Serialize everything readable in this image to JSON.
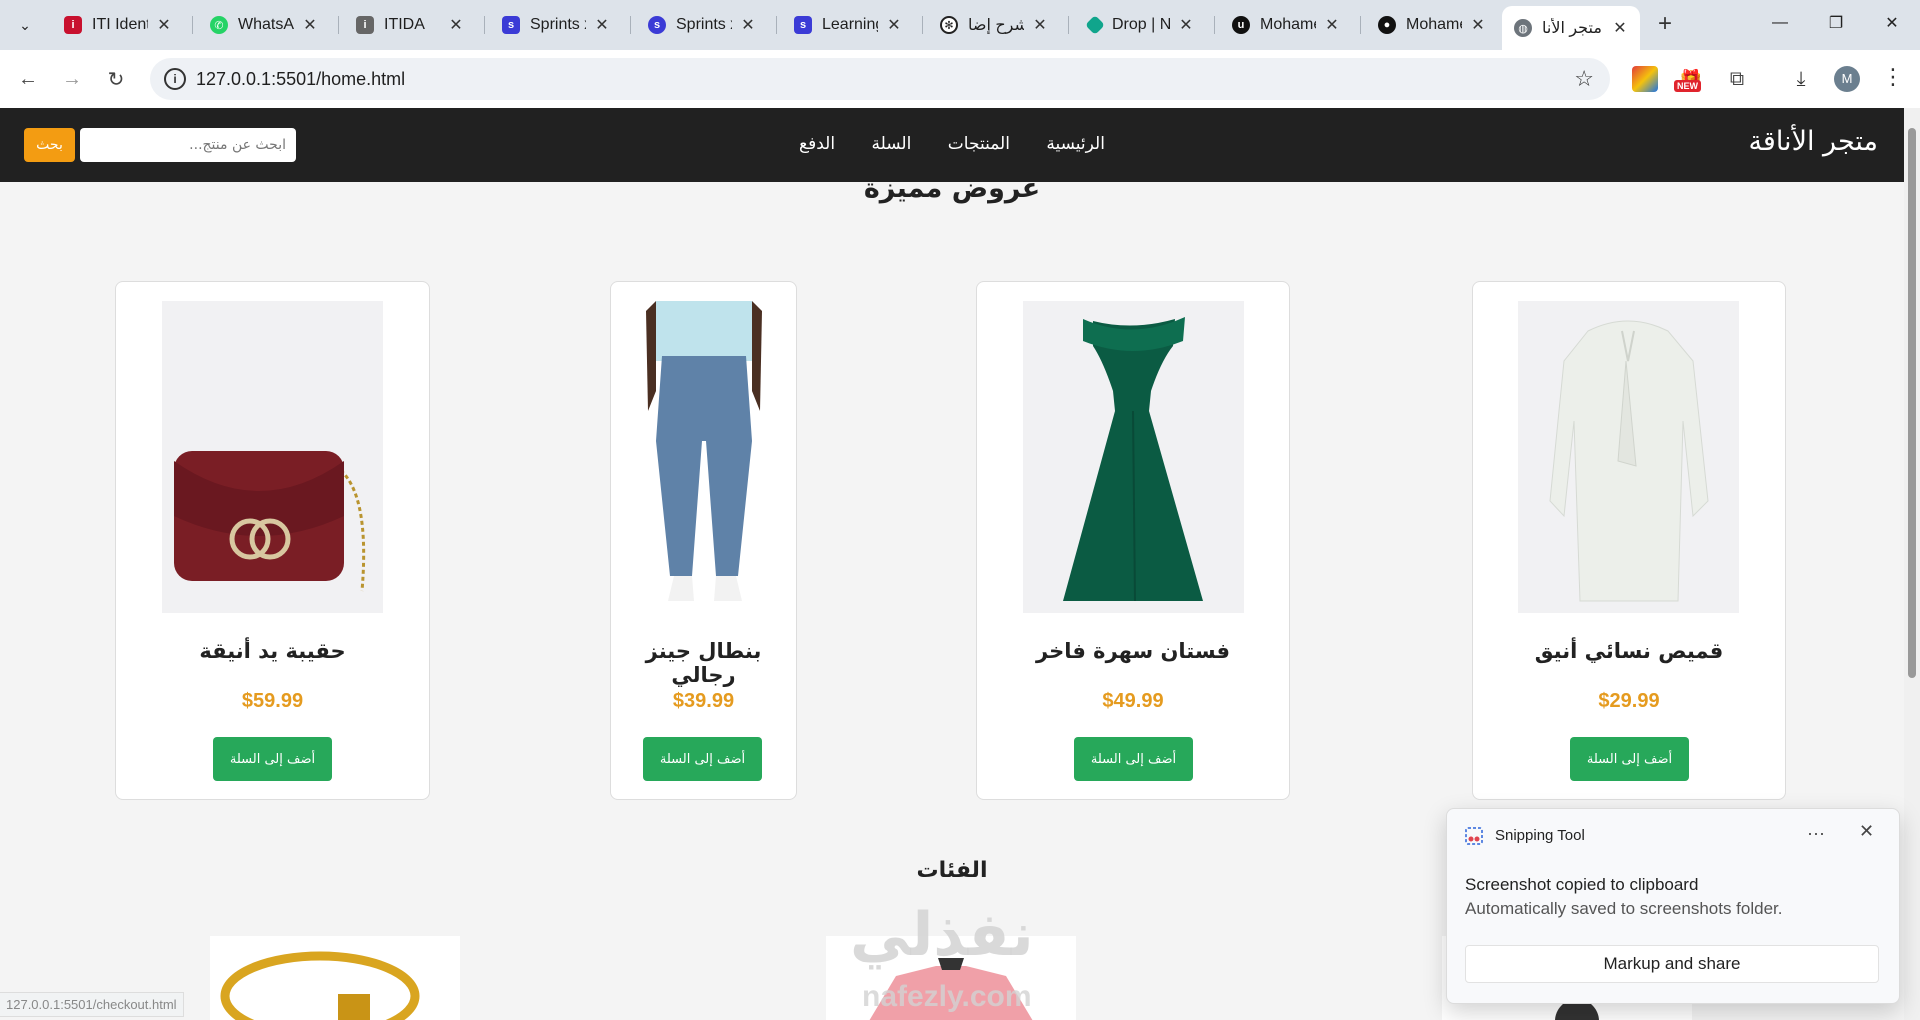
{
  "browser": {
    "tabs": [
      {
        "title": "ITI Identi",
        "icon": "iti-icon",
        "color": "#c8102e"
      },
      {
        "title": "WhatsAp",
        "icon": "whatsapp-icon",
        "color": "#25d366"
      },
      {
        "title": "ITIDA",
        "icon": "itida-icon",
        "color": "#555555"
      },
      {
        "title": "Sprints x",
        "icon": "sprints-icon",
        "color": "#3b3bd6"
      },
      {
        "title": "Sprints x",
        "icon": "sprints-icon",
        "color": "#3b3bd6"
      },
      {
        "title": "Learning",
        "icon": "sprints-icon",
        "color": "#3b3bd6"
      },
      {
        "title": "شرح إضا",
        "icon": "openai-icon",
        "color": "#222222"
      },
      {
        "title": "Drop | N",
        "icon": "drop-icon",
        "color": "#10a58c"
      },
      {
        "title": "Mohame",
        "icon": "upwork-icon",
        "color": "#111111"
      },
      {
        "title": "Mohame",
        "icon": "github-icon",
        "color": "#111111"
      },
      {
        "title": "متجر الأنا",
        "icon": "globe-icon",
        "color": "#555555"
      }
    ],
    "url": "127.0.0.1:5501/home.html",
    "new_badge": "NEW",
    "profile_initial": "M",
    "status_url": "127.0.0.1:5501/checkout.html"
  },
  "site": {
    "logo": "متجر الأناقة",
    "nav": [
      "الرئيسية",
      "المنتجات",
      "السلة",
      "الدفع"
    ],
    "search_placeholder": "ابحث عن منتج...",
    "search_button": "بحث",
    "featured_title": "عروض مميزة",
    "categories_title": "الفئات",
    "products": [
      {
        "name": "قميص نسائي أنيق",
        "price": "$29.99",
        "button": "أضف إلى السلة"
      },
      {
        "name": "فستان سهرة فاخر",
        "price": "$49.99",
        "button": "أضف إلى السلة"
      },
      {
        "name": "بنطال جينز رجالي",
        "price": "$39.99",
        "button": "أضف إلى السلة"
      },
      {
        "name": "حقيبة يد أنيقة",
        "price": "$59.99",
        "button": "أضف إلى السلة"
      }
    ]
  },
  "watermark": {
    "arabic": "نفذلي",
    "latin": "nafezly.com"
  },
  "toast": {
    "app": "Snipping Tool",
    "heading": "Screenshot copied to clipboard",
    "subtext": "Automatically saved to screenshots folder.",
    "action": "Markup and share"
  },
  "colors": {
    "accent_orange": "#f39c12",
    "price": "#e59b1f",
    "add_green": "#27a85a",
    "header_bg": "#212121"
  }
}
